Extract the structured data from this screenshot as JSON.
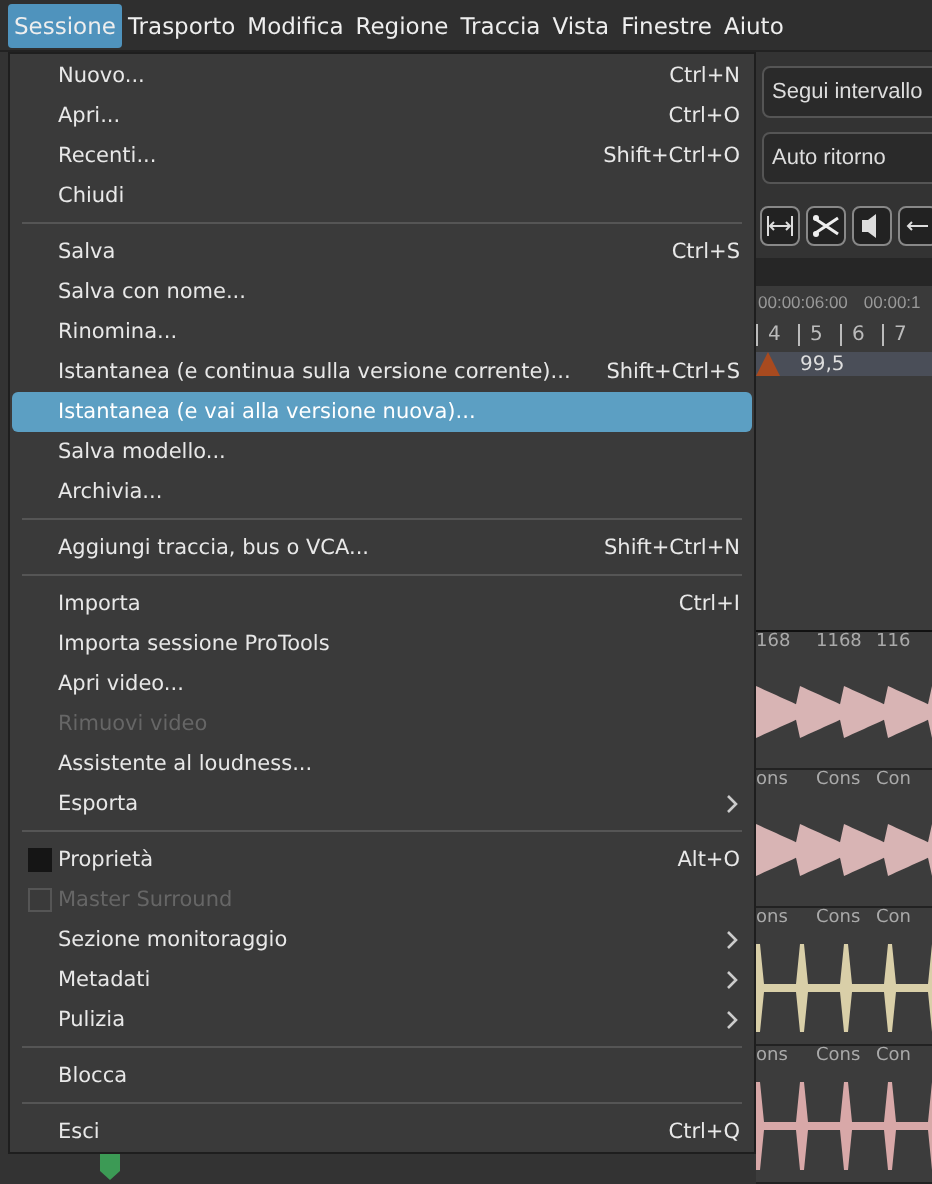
{
  "menubar": [
    {
      "label": "Sessione",
      "selected": true
    },
    {
      "label": "Trasporto",
      "selected": false
    },
    {
      "label": "Modifica",
      "selected": false
    },
    {
      "label": "Regione",
      "selected": false
    },
    {
      "label": "Traccia",
      "selected": false
    },
    {
      "label": "Vista",
      "selected": false
    },
    {
      "label": "Finestre",
      "selected": false
    },
    {
      "label": "Aiuto",
      "selected": false
    }
  ],
  "menu": {
    "groups": [
      [
        {
          "kind": "normal",
          "label": "Nuovo...",
          "shortcut": "Ctrl+N",
          "selected": false,
          "disabled": false
        },
        {
          "kind": "normal",
          "label": "Apri...",
          "shortcut": "Ctrl+O",
          "selected": false,
          "disabled": false
        },
        {
          "kind": "normal",
          "label": "Recenti...",
          "shortcut": "Shift+Ctrl+O",
          "selected": false,
          "disabled": false
        },
        {
          "kind": "normal",
          "label": "Chiudi",
          "selected": false,
          "disabled": false
        }
      ],
      [
        {
          "kind": "normal",
          "label": "Salva",
          "shortcut": "Ctrl+S",
          "selected": false,
          "disabled": false
        },
        {
          "kind": "normal",
          "label": "Salva con nome...",
          "selected": false,
          "disabled": false
        },
        {
          "kind": "normal",
          "label": "Rinomina...",
          "selected": false,
          "disabled": false
        },
        {
          "kind": "normal",
          "label": "Istantanea (e continua sulla versione corrente)...",
          "shortcut": "Shift+Ctrl+S",
          "selected": false,
          "disabled": false
        },
        {
          "kind": "normal",
          "label": "Istantanea (e vai alla versione nuova)...",
          "selected": true,
          "disabled": false
        },
        {
          "kind": "normal",
          "label": "Salva modello...",
          "selected": false,
          "disabled": false
        },
        {
          "kind": "normal",
          "label": "Archivia...",
          "selected": false,
          "disabled": false
        }
      ],
      [
        {
          "kind": "normal",
          "label": "Aggiungi traccia, bus o VCA...",
          "shortcut": "Shift+Ctrl+N",
          "selected": false,
          "disabled": false
        }
      ],
      [
        {
          "kind": "normal",
          "label": "Importa",
          "shortcut": "Ctrl+I",
          "selected": false,
          "disabled": false
        },
        {
          "kind": "normal",
          "label": "Importa sessione ProTools",
          "selected": false,
          "disabled": false
        },
        {
          "kind": "normal",
          "label": "Apri video...",
          "selected": false,
          "disabled": false
        },
        {
          "kind": "normal",
          "label": "Rimuovi video",
          "selected": false,
          "disabled": true
        },
        {
          "kind": "normal",
          "label": "Assistente al loudness...",
          "selected": false,
          "disabled": false
        },
        {
          "kind": "submenu",
          "label": "Esporta",
          "selected": false,
          "disabled": false
        }
      ],
      [
        {
          "kind": "checkbox",
          "label": "Proprietà",
          "shortcut": "Alt+O",
          "checked": false,
          "selected": false,
          "disabled": false
        },
        {
          "kind": "checkbox",
          "label": "Master Surround",
          "checked": false,
          "selected": false,
          "disabled": true
        },
        {
          "kind": "submenu",
          "label": "Sezione monitoraggio",
          "selected": false,
          "disabled": false
        },
        {
          "kind": "submenu",
          "label": "Metadati",
          "selected": false,
          "disabled": false
        },
        {
          "kind": "submenu",
          "label": "Pulizia",
          "selected": false,
          "disabled": false
        }
      ],
      [
        {
          "kind": "normal",
          "label": "Blocca",
          "selected": false,
          "disabled": false
        }
      ],
      [
        {
          "kind": "normal",
          "label": "Esci",
          "shortcut": "Ctrl+Q",
          "selected": false,
          "disabled": false
        }
      ]
    ]
  },
  "toolbar": {
    "buttons": [
      "Segui intervallo",
      "Auto ritorno"
    ]
  },
  "ruler": {
    "timecodes": [
      "00:00:06:00",
      "00:00:1"
    ],
    "bars": [
      "4",
      "5",
      "6",
      "7"
    ],
    "tempo": "99,5"
  },
  "tracks": [
    {
      "regions": [
        "168",
        "1168",
        "116"
      ],
      "color": "#d8b4b4"
    },
    {
      "regions": [
        "ons",
        "Cons",
        "Con"
      ],
      "color": "#d8b4b4"
    },
    {
      "regions": [
        "ons",
        "Cons",
        "Con"
      ],
      "color": "#d9cfa8"
    },
    {
      "regions": [
        "ons",
        "Cons",
        "Con"
      ],
      "color": "#d8a8a8"
    }
  ]
}
